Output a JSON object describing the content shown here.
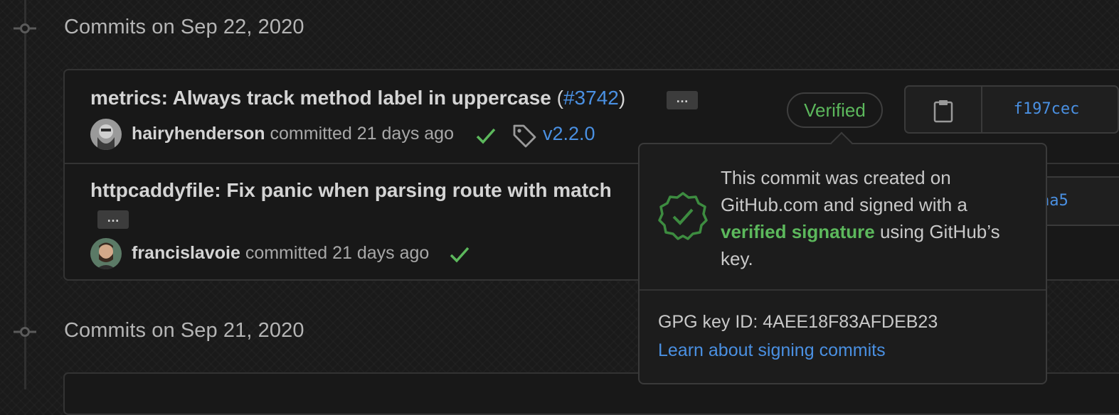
{
  "groups": [
    {
      "title": "Commits on Sep 22, 2020"
    },
    {
      "title": "Commits on Sep 21, 2020"
    }
  ],
  "commits": [
    {
      "message": "metrics: Always track method label in uppercase",
      "pr_open": "(",
      "pr": "#3742",
      "pr_close": ")",
      "ellipsis": "…",
      "author": "hairyhenderson",
      "committed": "committed 21 days ago",
      "tag": "v2.2.0",
      "badge": "Verified",
      "sha": "f197cec",
      "copy_icon": "clipboard-icon",
      "status_icon": "check-icon",
      "tag_icon": "tag-icon"
    },
    {
      "message": "httpcaddyfile: Fix panic when parsing route with match",
      "ellipsis": "…",
      "author": "francislavoie",
      "committed": "committed 21 days ago",
      "sha_partial": "aa5",
      "status_icon": "check-icon"
    }
  ],
  "popover": {
    "text_before": "This commit was created on GitHub.com and signed with a ",
    "link_text": "verified signature",
    "text_after": " using GitHub’s key.",
    "gpg_label": "GPG key ID: 4AEE18F83AFDEB23",
    "learn_link": "Learn about signing commits",
    "icon": "verified-seal-icon"
  },
  "colors": {
    "background": "#1a1a1a",
    "link": "#4a90e2",
    "success": "#5cb85c"
  }
}
